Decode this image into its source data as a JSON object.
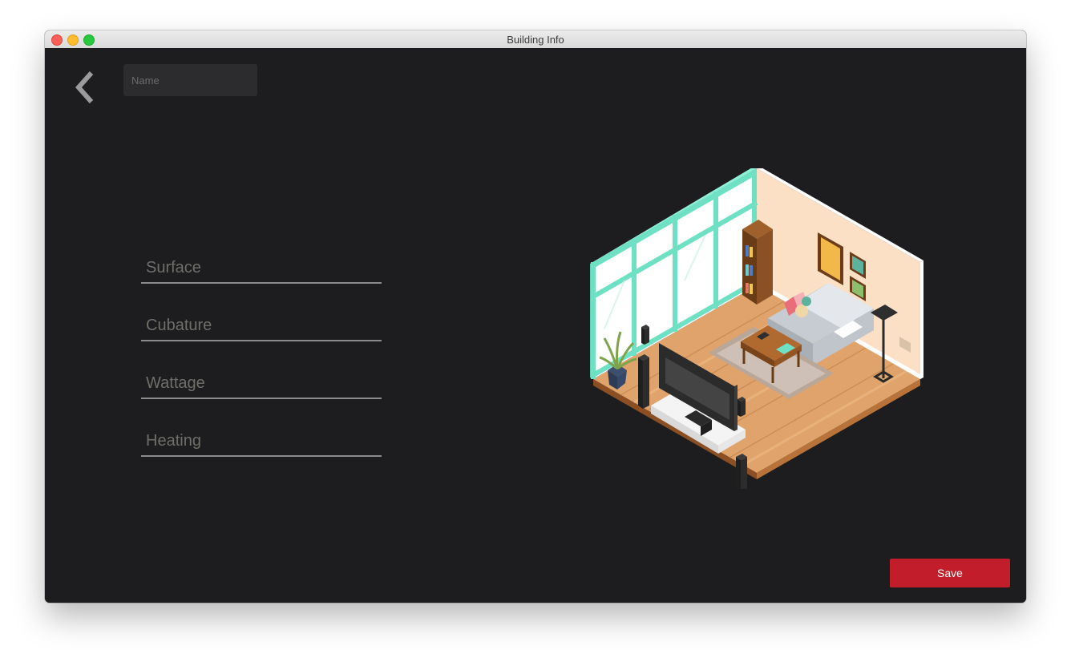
{
  "window": {
    "title": "Building Info"
  },
  "header": {
    "back_icon": "chevron-left-icon",
    "name_placeholder": "Name"
  },
  "form": {
    "fields": [
      {
        "key": "surface",
        "placeholder": "Surface"
      },
      {
        "key": "cubature",
        "placeholder": "Cubature"
      },
      {
        "key": "wattage",
        "placeholder": "Wattage"
      },
      {
        "key": "heating",
        "placeholder": "Heating"
      }
    ]
  },
  "actions": {
    "save_label": "Save"
  },
  "colors": {
    "background": "#1d1d1f",
    "accent": "#c11d2b",
    "field_underline": "#8c8c8c",
    "window_frame": "#6ee0c4"
  },
  "illustration": {
    "subject": "isometric-living-room"
  }
}
